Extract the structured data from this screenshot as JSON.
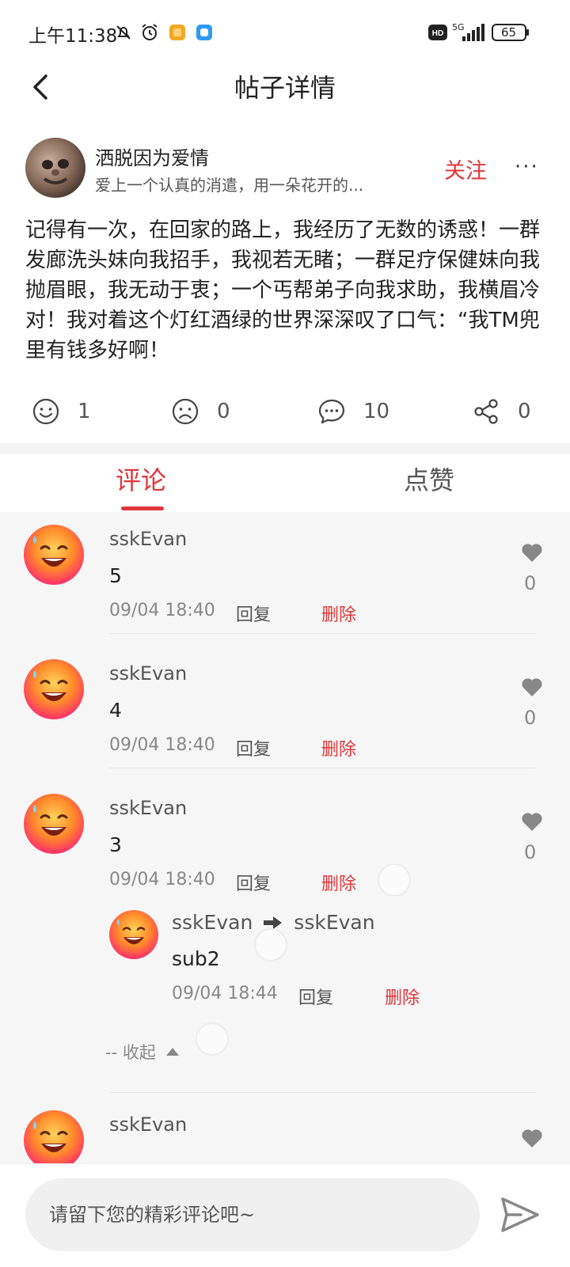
{
  "status_bar": {
    "time": "上午11:38",
    "network": "5G",
    "battery": "65",
    "hd_label": "HD"
  },
  "header": {
    "title": "帖子详情"
  },
  "post": {
    "author_name": "洒脱因为爱情",
    "author_signature": "爱上一个认真的消遣，用一朵花开的...",
    "follow_label": "关注",
    "more_label": "···",
    "content": "记得有一次，在回家的路上，我经历了无数的诱惑！一群发廊洗头妹向我招手，我视若无睹；一群足疗保健妹向我抛眉眼，我无动于衷；一个丐帮弟子向我求助，我横眉冷对！我对着这个灯红酒绿的世界深深叹了口气：“我TM兜里有钱多好啊！",
    "actions": {
      "happy_count": "1",
      "sad_count": "0",
      "comment_count": "10",
      "share_count": "0"
    }
  },
  "tabs": {
    "comments_label": "评论",
    "likes_label": "点赞"
  },
  "comments": [
    {
      "user": "sskEvan",
      "text": "5",
      "time": "09/04 18:40",
      "reply": "回复",
      "delete": "删除",
      "likes": "0"
    },
    {
      "user": "sskEvan",
      "text": "4",
      "time": "09/04 18:40",
      "reply": "回复",
      "delete": "删除",
      "likes": "0"
    },
    {
      "user": "sskEvan",
      "text": "3",
      "time": "09/04 18:40",
      "reply": "回复",
      "delete": "删除",
      "likes": "0",
      "sub": {
        "from": "sskEvan",
        "to": "sskEvan",
        "text": "sub2",
        "time": "09/04 18:44",
        "reply": "回复",
        "delete": "删除"
      },
      "collapse_label": "-- 收起"
    },
    {
      "user": "sskEvan"
    }
  ],
  "composer": {
    "placeholder": "请留下您的精彩评论吧~"
  },
  "colors": {
    "accent": "#e0373b",
    "muted": "#888888",
    "list_bg": "#f6f6f6"
  }
}
